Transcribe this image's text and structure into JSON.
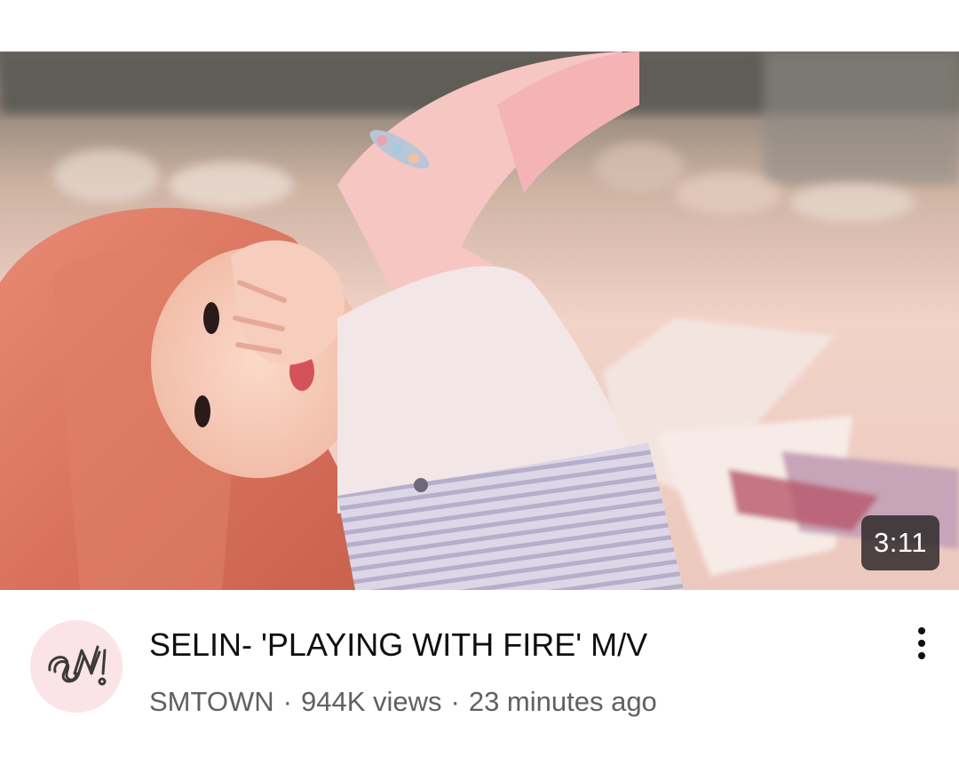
{
  "video": {
    "duration": "3:11",
    "title": "SELIN- 'PLAYING WITH FIRE' M/V",
    "channel": "SMTOWN",
    "views": "944K views",
    "age": "23 minutes ago",
    "separator": "·"
  },
  "icons": {
    "avatar": "smtown-logo-icon",
    "more": "more-vertical-icon"
  },
  "colors": {
    "avatar_background": "#fbe4e8",
    "logo_stroke": "#3a3a3a",
    "title_text": "#0f0f0f",
    "secondary_text": "#606060"
  }
}
